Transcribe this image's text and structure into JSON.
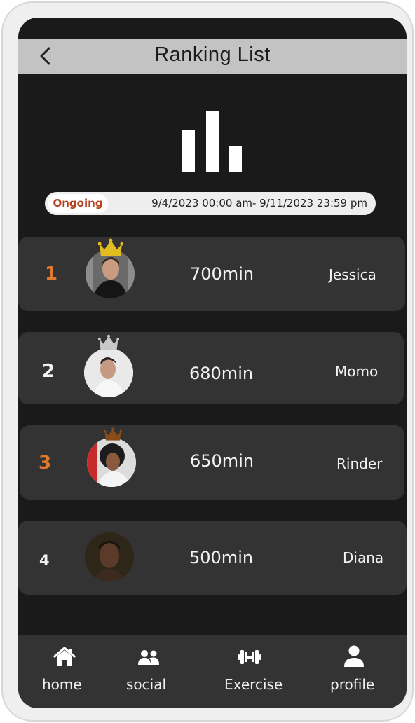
{
  "header": {
    "title": "Ranking List",
    "back_icon": "chevron-left-icon"
  },
  "hero": {
    "icon": "bar-chart-icon"
  },
  "period": {
    "status": "Ongoing",
    "range": "9/4/2023 00:00 am- 9/11/2023 23:59 pm"
  },
  "ranking": [
    {
      "rank": "1",
      "minutes": "700min",
      "name": "Jessica",
      "crown": "gold-crown-icon",
      "rank_color": "#e07a2e"
    },
    {
      "rank": "2",
      "minutes": "680min",
      "name": "Momo",
      "crown": "silver-crown-icon",
      "rank_color": "#f2f2f2"
    },
    {
      "rank": "3",
      "minutes": "650min",
      "name": "Rinder",
      "crown": "bronze-crown-icon",
      "rank_color": "#e07a2e"
    },
    {
      "rank": "4",
      "minutes": "500min",
      "name": "Diana",
      "crown": "",
      "rank_color": "#f2f2f2"
    }
  ],
  "nav": {
    "items": [
      {
        "label": "home",
        "icon": "home-icon"
      },
      {
        "label": "social",
        "icon": "people-icon"
      },
      {
        "label": "Exercise",
        "icon": "dumbbell-icon"
      },
      {
        "label": "profile",
        "icon": "person-icon"
      }
    ]
  },
  "colors": {
    "screen_bg": "#1a1a1a",
    "card_bg": "#333333",
    "header_bg": "#c3c3c3",
    "gold": "#e3bc1f",
    "silver": "#c8c8c8",
    "bronze": "#8a4b16",
    "accent_orange": "#e07a2e",
    "status_text": "#b5411f"
  }
}
